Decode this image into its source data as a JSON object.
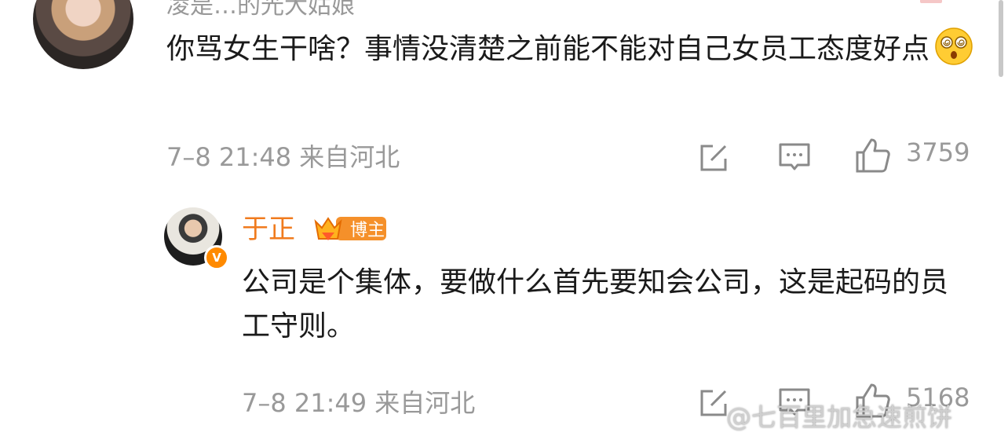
{
  "comment1": {
    "username_partial": "凌是…的光大姑娘",
    "text": "你骂女生干啥？事情没清楚之前能不能对自己女员工态度好点",
    "emoji": "dizzy-face-emoji",
    "meta": "7–8 21:48 来自河北",
    "likes": "3759"
  },
  "reply": {
    "username": "于正",
    "badge": "博主",
    "text": "公司是个集体，要做什么首先要知会公司，这是起码的员工守则。",
    "meta": "7–8 21:49 来自河北",
    "likes": "5168"
  },
  "watermark": "@七百里加急速煎饼",
  "colors": {
    "accent": "#f07b1e",
    "meta": "#999999",
    "verified": "#ff8a00"
  }
}
